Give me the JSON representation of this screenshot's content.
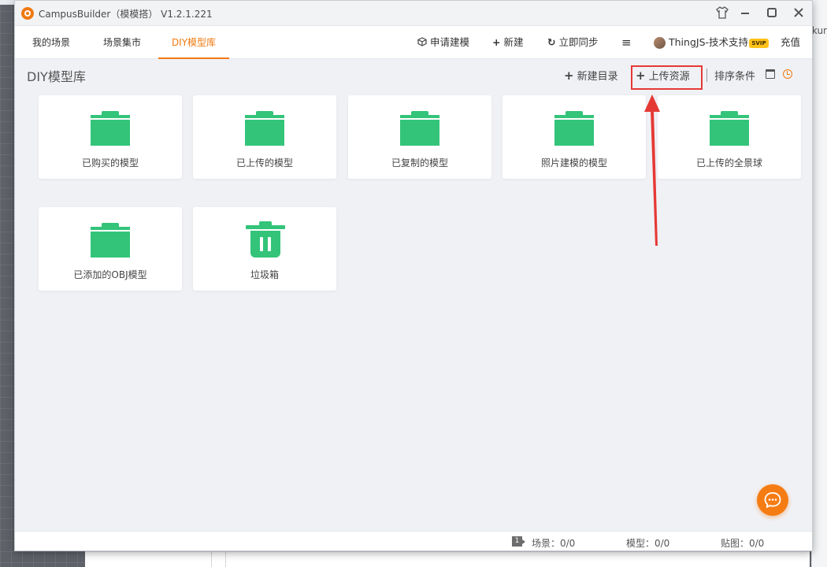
{
  "window": {
    "title": "CampusBuilder（模模搭） V1.2.1.221",
    "controls": [
      "shirt-icon",
      "minimize-icon",
      "maximize-icon",
      "close-icon"
    ]
  },
  "nav": {
    "tabs": [
      {
        "label": "我的场景",
        "active": false
      },
      {
        "label": "场景集市",
        "active": false
      },
      {
        "label": "DIY模型库",
        "active": true
      }
    ],
    "apply_modeling": "申请建模",
    "new": "新建",
    "sync": "立即同步",
    "menu_icon": "hamburger-icon",
    "user": "ThingJS-技术支持",
    "vip_badge": "SVIP",
    "recharge": "充值"
  },
  "content": {
    "page_title": "DIY模型库",
    "toolbar": {
      "new_folder": "新建目录",
      "upload": "上传资源",
      "sort": "排序条件"
    },
    "folders": [
      {
        "label": "已购买的模型",
        "icon": "folder-icon"
      },
      {
        "label": "已上传的模型",
        "icon": "folder-icon"
      },
      {
        "label": "已复制的模型",
        "icon": "folder-icon"
      },
      {
        "label": "照片建模的模型",
        "icon": "folder-icon"
      },
      {
        "label": "已上传的全景球",
        "icon": "folder-icon"
      },
      {
        "label": "已添加的OBJ模型",
        "icon": "folder-icon"
      },
      {
        "label": "垃圾箱",
        "icon": "trash-icon"
      }
    ]
  },
  "status": {
    "page_number": "1",
    "scenes": "场景：0/0",
    "models": "模型：0/0",
    "textures": "贴图：0/0"
  },
  "background": {
    "right_text": "kur"
  },
  "colors": {
    "accent": "#f0790f",
    "folder_green": "#33c47a",
    "highlight_red": "#e53935"
  }
}
